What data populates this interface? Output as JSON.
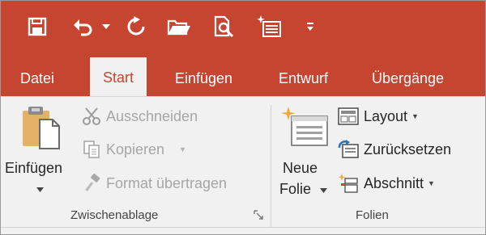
{
  "colors": {
    "accent": "#c64531",
    "ribbon_bg": "#f1f1f1",
    "text": "#262626",
    "disabled_text": "#a6a6a6"
  },
  "quick_access": {
    "items": [
      {
        "icon": "save-icon"
      },
      {
        "icon": "undo-icon"
      },
      {
        "icon": "undo-dropdown-icon"
      },
      {
        "icon": "redo-icon"
      },
      {
        "icon": "open-folder-icon"
      },
      {
        "icon": "print-preview-icon"
      },
      {
        "icon": "new-slide-icon"
      },
      {
        "icon": "customize-toolbar-icon"
      }
    ]
  },
  "tabs": [
    {
      "label": "Datei",
      "active": false
    },
    {
      "label": "Start",
      "active": true
    },
    {
      "label": "Einfügen",
      "active": false
    },
    {
      "label": "Entwurf",
      "active": false
    },
    {
      "label": "Übergänge",
      "active": false
    }
  ],
  "clipboard": {
    "paste_label": "Einfügen",
    "cut_label": "Ausschneiden",
    "copy_label": "Kopieren",
    "format_painter_label": "Format übertragen",
    "group_label": "Zwischenablage"
  },
  "slides": {
    "new_slide_line1": "Neue",
    "new_slide_line2": "Folie",
    "layout_label": "Layout",
    "reset_label": "Zurücksetzen",
    "section_label": "Abschnitt",
    "group_label": "Folien"
  }
}
